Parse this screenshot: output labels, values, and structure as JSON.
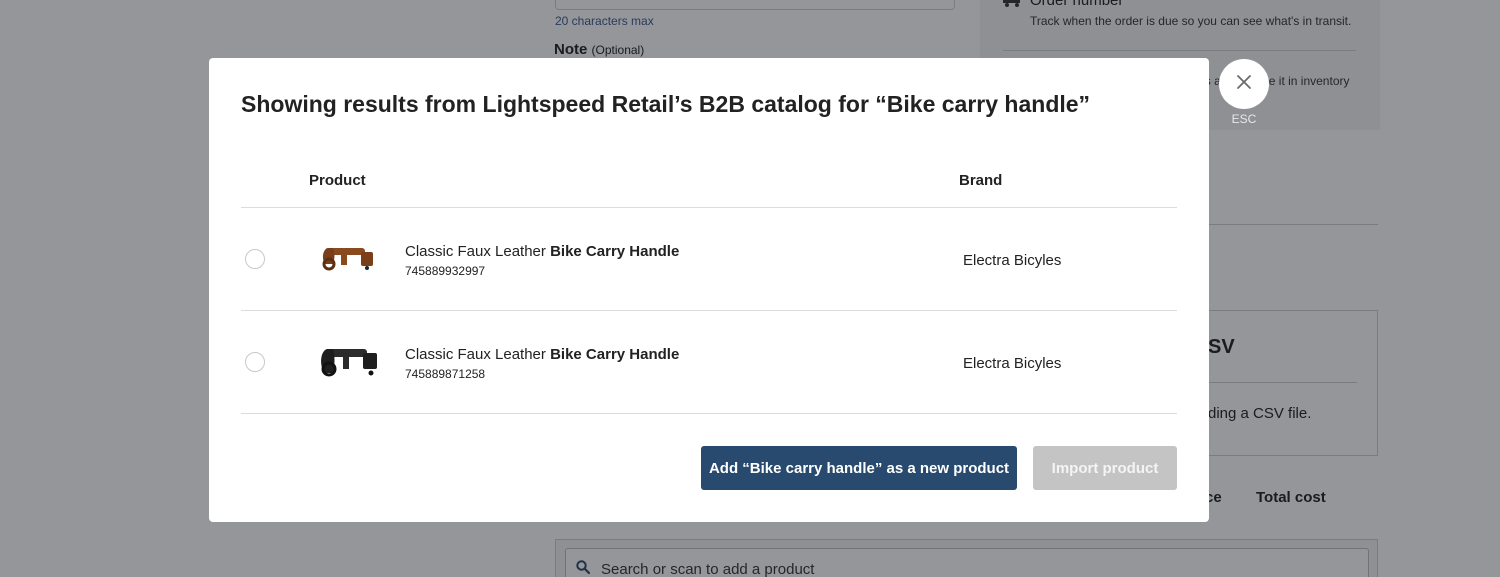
{
  "background": {
    "char_limit_hint": "20 characters max",
    "note_label": "Note",
    "note_optional": "(Optional)",
    "order_number_title": "Order number",
    "order_number_desc": "Track when the order is due so you can see what's in transit.",
    "visible_to_text": "Make this order visible to cashiers and include it in inventory",
    "csv_title_partial": "SV",
    "csv_desc_partial": "ding a CSV file.",
    "col_price_partial": "ce",
    "col_total_cost": "Total cost",
    "search_placeholder": "Search or scan to add a product"
  },
  "modal": {
    "title": "Showing results from Lightspeed Retail’s B2B catalog for “Bike carry handle”",
    "columns": {
      "product": "Product",
      "brand": "Brand"
    },
    "rows": [
      {
        "name_prefix": "Classic Faux Leather ",
        "name_bold": "Bike Carry Handle",
        "sku": "745889932997",
        "brand": "Electra Bicyles",
        "color": "brown"
      },
      {
        "name_prefix": "Classic Faux Leather ",
        "name_bold": "Bike Carry Handle",
        "sku": "745889871258",
        "brand": "Electra Bicyles",
        "color": "black"
      }
    ],
    "add_new_button": "Add “Bike carry handle” as a new product",
    "import_button": "Import product"
  },
  "close": {
    "esc_label": "ESC",
    "icon": "close-icon"
  },
  "colors": {
    "primary": "#284a6e",
    "disabled": "#c4c4c4",
    "link": "#3b5a8c"
  }
}
